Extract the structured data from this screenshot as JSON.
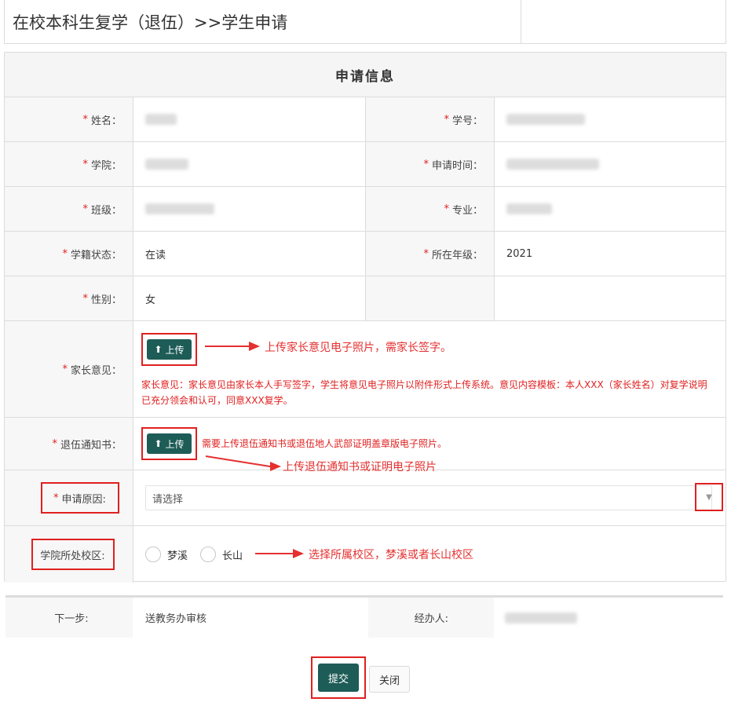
{
  "header": {
    "title": "在校本科生复学（退伍）>>学生申请"
  },
  "form": {
    "section_title": "申请信息",
    "required_mark": "*",
    "fields": {
      "name_label": "姓名：",
      "student_id_label": "学号：",
      "college_label": "学院：",
      "apply_time_label": "申请时间：",
      "class_label": "班级：",
      "major_label": "专业：",
      "status_label": "学籍状态：",
      "status_value": "在读",
      "grade_label": "所在年级：",
      "grade_value": "2021",
      "gender_label": "性别：",
      "gender_value": "女",
      "parent_label": "家长意见：",
      "discharge_label": "退伍通知书：",
      "reason_label": "申请原因:",
      "campus_label": "学院所处校区:"
    },
    "upload_label": "上传",
    "parent_note": "家长意见：家长意见由家长本人手写签字，学生将意见电子照片以附件形式上传系统。意见内容模板：本人XXX（家长姓名）对复学说明已充分领会和认可，同意XXX复学。",
    "discharge_note": "需要上传退伍通知书或退伍地人武部证明盖章版电子照片。",
    "reason_placeholder": "请选择",
    "campus_options": [
      "梦溪",
      "长山"
    ]
  },
  "annotations": {
    "parent_upload": "上传家长意见电子照片，需家长签字。",
    "discharge_upload": "上传退伍通知书或证明电子照片",
    "campus_select": "选择所属校区，梦溪或者长山校区"
  },
  "footer": {
    "next_step_label": "下一步:",
    "next_step_value": "送教务办审核",
    "handler_label": "经办人:"
  },
  "buttons": {
    "submit": "提交",
    "close": "关闭"
  },
  "colors": {
    "primary": "#1e5c57",
    "required": "#e02020",
    "annotation": "#e53030"
  }
}
